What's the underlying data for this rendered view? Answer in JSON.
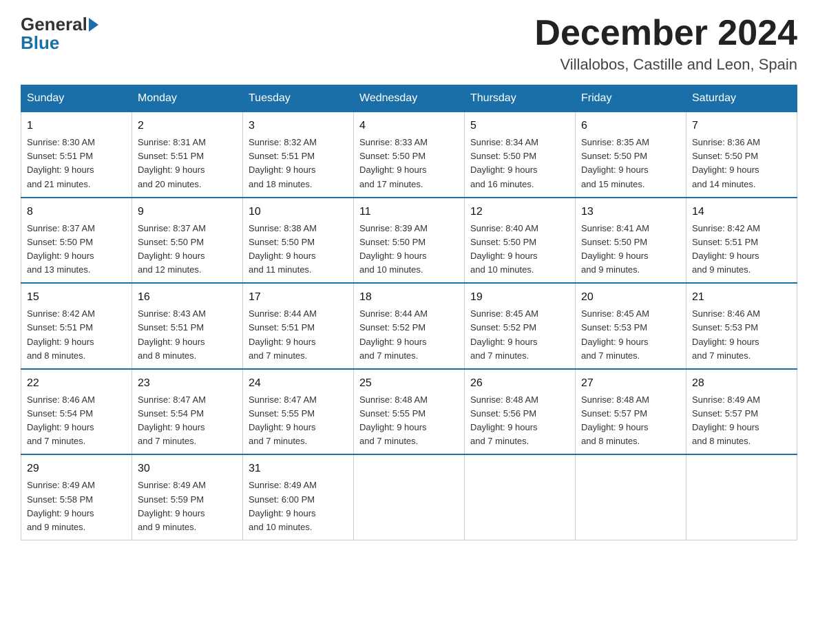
{
  "header": {
    "logo_general": "General",
    "logo_blue": "Blue",
    "title": "December 2024",
    "subtitle": "Villalobos, Castille and Leon, Spain"
  },
  "days_of_week": [
    "Sunday",
    "Monday",
    "Tuesday",
    "Wednesday",
    "Thursday",
    "Friday",
    "Saturday"
  ],
  "weeks": [
    [
      {
        "day": "1",
        "info": "Sunrise: 8:30 AM\nSunset: 5:51 PM\nDaylight: 9 hours\nand 21 minutes."
      },
      {
        "day": "2",
        "info": "Sunrise: 8:31 AM\nSunset: 5:51 PM\nDaylight: 9 hours\nand 20 minutes."
      },
      {
        "day": "3",
        "info": "Sunrise: 8:32 AM\nSunset: 5:51 PM\nDaylight: 9 hours\nand 18 minutes."
      },
      {
        "day": "4",
        "info": "Sunrise: 8:33 AM\nSunset: 5:50 PM\nDaylight: 9 hours\nand 17 minutes."
      },
      {
        "day": "5",
        "info": "Sunrise: 8:34 AM\nSunset: 5:50 PM\nDaylight: 9 hours\nand 16 minutes."
      },
      {
        "day": "6",
        "info": "Sunrise: 8:35 AM\nSunset: 5:50 PM\nDaylight: 9 hours\nand 15 minutes."
      },
      {
        "day": "7",
        "info": "Sunrise: 8:36 AM\nSunset: 5:50 PM\nDaylight: 9 hours\nand 14 minutes."
      }
    ],
    [
      {
        "day": "8",
        "info": "Sunrise: 8:37 AM\nSunset: 5:50 PM\nDaylight: 9 hours\nand 13 minutes."
      },
      {
        "day": "9",
        "info": "Sunrise: 8:37 AM\nSunset: 5:50 PM\nDaylight: 9 hours\nand 12 minutes."
      },
      {
        "day": "10",
        "info": "Sunrise: 8:38 AM\nSunset: 5:50 PM\nDaylight: 9 hours\nand 11 minutes."
      },
      {
        "day": "11",
        "info": "Sunrise: 8:39 AM\nSunset: 5:50 PM\nDaylight: 9 hours\nand 10 minutes."
      },
      {
        "day": "12",
        "info": "Sunrise: 8:40 AM\nSunset: 5:50 PM\nDaylight: 9 hours\nand 10 minutes."
      },
      {
        "day": "13",
        "info": "Sunrise: 8:41 AM\nSunset: 5:50 PM\nDaylight: 9 hours\nand 9 minutes."
      },
      {
        "day": "14",
        "info": "Sunrise: 8:42 AM\nSunset: 5:51 PM\nDaylight: 9 hours\nand 9 minutes."
      }
    ],
    [
      {
        "day": "15",
        "info": "Sunrise: 8:42 AM\nSunset: 5:51 PM\nDaylight: 9 hours\nand 8 minutes."
      },
      {
        "day": "16",
        "info": "Sunrise: 8:43 AM\nSunset: 5:51 PM\nDaylight: 9 hours\nand 8 minutes."
      },
      {
        "day": "17",
        "info": "Sunrise: 8:44 AM\nSunset: 5:51 PM\nDaylight: 9 hours\nand 7 minutes."
      },
      {
        "day": "18",
        "info": "Sunrise: 8:44 AM\nSunset: 5:52 PM\nDaylight: 9 hours\nand 7 minutes."
      },
      {
        "day": "19",
        "info": "Sunrise: 8:45 AM\nSunset: 5:52 PM\nDaylight: 9 hours\nand 7 minutes."
      },
      {
        "day": "20",
        "info": "Sunrise: 8:45 AM\nSunset: 5:53 PM\nDaylight: 9 hours\nand 7 minutes."
      },
      {
        "day": "21",
        "info": "Sunrise: 8:46 AM\nSunset: 5:53 PM\nDaylight: 9 hours\nand 7 minutes."
      }
    ],
    [
      {
        "day": "22",
        "info": "Sunrise: 8:46 AM\nSunset: 5:54 PM\nDaylight: 9 hours\nand 7 minutes."
      },
      {
        "day": "23",
        "info": "Sunrise: 8:47 AM\nSunset: 5:54 PM\nDaylight: 9 hours\nand 7 minutes."
      },
      {
        "day": "24",
        "info": "Sunrise: 8:47 AM\nSunset: 5:55 PM\nDaylight: 9 hours\nand 7 minutes."
      },
      {
        "day": "25",
        "info": "Sunrise: 8:48 AM\nSunset: 5:55 PM\nDaylight: 9 hours\nand 7 minutes."
      },
      {
        "day": "26",
        "info": "Sunrise: 8:48 AM\nSunset: 5:56 PM\nDaylight: 9 hours\nand 7 minutes."
      },
      {
        "day": "27",
        "info": "Sunrise: 8:48 AM\nSunset: 5:57 PM\nDaylight: 9 hours\nand 8 minutes."
      },
      {
        "day": "28",
        "info": "Sunrise: 8:49 AM\nSunset: 5:57 PM\nDaylight: 9 hours\nand 8 minutes."
      }
    ],
    [
      {
        "day": "29",
        "info": "Sunrise: 8:49 AM\nSunset: 5:58 PM\nDaylight: 9 hours\nand 9 minutes."
      },
      {
        "day": "30",
        "info": "Sunrise: 8:49 AM\nSunset: 5:59 PM\nDaylight: 9 hours\nand 9 minutes."
      },
      {
        "day": "31",
        "info": "Sunrise: 8:49 AM\nSunset: 6:00 PM\nDaylight: 9 hours\nand 10 minutes."
      },
      {
        "day": "",
        "info": ""
      },
      {
        "day": "",
        "info": ""
      },
      {
        "day": "",
        "info": ""
      },
      {
        "day": "",
        "info": ""
      }
    ]
  ]
}
